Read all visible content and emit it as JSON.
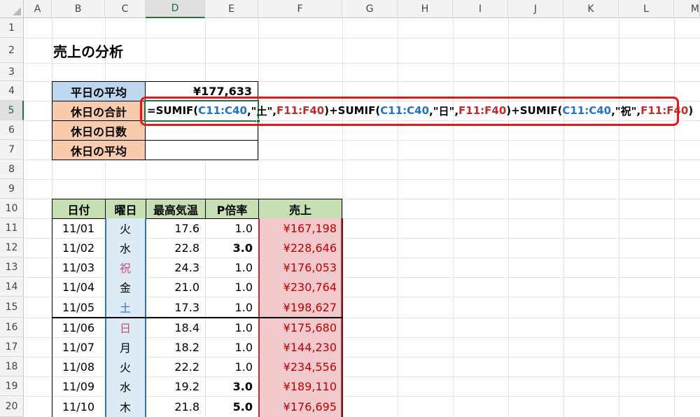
{
  "columns": [
    "A",
    "B",
    "C",
    "D",
    "E",
    "F",
    "G",
    "H",
    "I",
    "J",
    "K",
    "L",
    "M"
  ],
  "rows": [
    "1",
    "2",
    "3",
    "4",
    "5",
    "6",
    "7",
    "8",
    "9",
    "10",
    "11",
    "12",
    "13",
    "14",
    "15",
    "16",
    "17",
    "18",
    "19",
    "20"
  ],
  "title": "売上の分析",
  "summary": {
    "labels": [
      "平日の平均",
      "休日の合計",
      "休日の日数",
      "休日の平均"
    ],
    "weekday_avg": "¥177,633"
  },
  "formula": {
    "f1": "=SUMIF(",
    "r1": "C11:C40",
    "s1": ",\"土\",",
    "r2": "F11:F40",
    "s2": ")+SUMIF(",
    "r3": "C11:C40",
    "s3": ",\"日\",",
    "r4": "F11:F40",
    "s4": ")+SUMIF(",
    "r5": "C11:C40",
    "s5": ",\"祝\",",
    "r6": "F11:F40",
    "s6": ")"
  },
  "table": {
    "headers": [
      "日付",
      "曜日",
      "最高気温",
      "P倍率",
      "売上"
    ],
    "rows": [
      {
        "date": "11/01",
        "day": "火",
        "temp": "17.6",
        "p": "1.0",
        "sales": "¥167,198"
      },
      {
        "date": "11/02",
        "day": "水",
        "temp": "22.8",
        "p": "3.0",
        "sales": "¥228,646"
      },
      {
        "date": "11/03",
        "day": "祝",
        "temp": "24.3",
        "p": "1.0",
        "sales": "¥176,053"
      },
      {
        "date": "11/04",
        "day": "金",
        "temp": "21.0",
        "p": "1.0",
        "sales": "¥230,764"
      },
      {
        "date": "11/05",
        "day": "土",
        "temp": "17.3",
        "p": "1.0",
        "sales": "¥198,627"
      },
      {
        "date": "11/06",
        "day": "日",
        "temp": "18.4",
        "p": "1.0",
        "sales": "¥175,680"
      },
      {
        "date": "11/07",
        "day": "月",
        "temp": "18.2",
        "p": "1.0",
        "sales": "¥144,230"
      },
      {
        "date": "11/08",
        "day": "火",
        "temp": "22.2",
        "p": "1.0",
        "sales": "¥234,556"
      },
      {
        "date": "11/09",
        "day": "水",
        "temp": "19.2",
        "p": "3.0",
        "sales": "¥189,110"
      },
      {
        "date": "11/10",
        "day": "木",
        "temp": "21.8",
        "p": "5.0",
        "sales": "¥176,695"
      }
    ]
  },
  "colors": {
    "header_green": "#c6e0b4",
    "label_orange": "#f8cbad",
    "label_blue": "#bdd7ee",
    "sales_pink": "#f2c9cc",
    "highlight_red": "#e8141c",
    "holiday_red": "#c0506e",
    "saturday_blue": "#2f75b5"
  }
}
